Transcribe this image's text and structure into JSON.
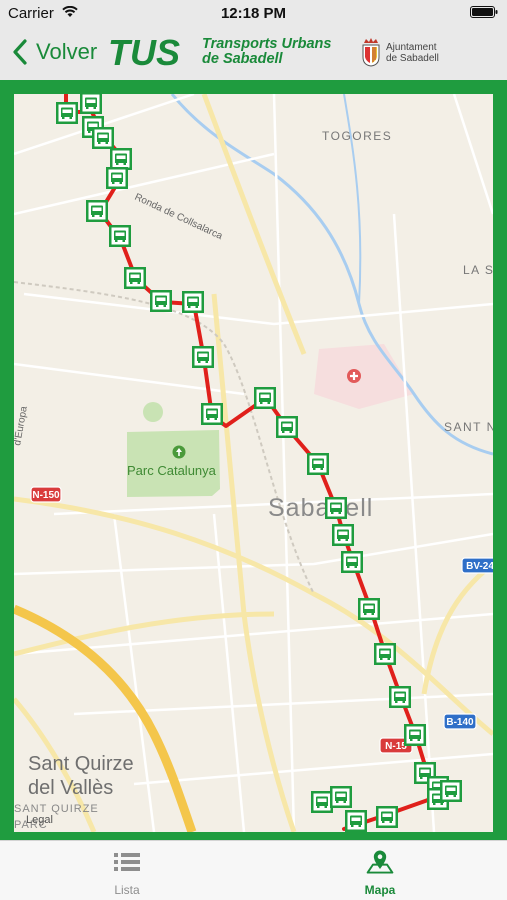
{
  "status": {
    "carrier": "Carrier",
    "time": "12:18 PM"
  },
  "nav": {
    "back_label": "Volver",
    "logo_text": "TUS",
    "line1": "Transports Urbans",
    "line2": "de Sabadell",
    "ajuntament_line1": "Ajuntament",
    "ajuntament_line2": "de Sabadell"
  },
  "map": {
    "labels": {
      "togores": "TOGORES",
      "la_s": "LA S",
      "sant_n": "SANT N",
      "ronda": "Ronda de Collsalarca",
      "europa": "d'Europa",
      "parc": "Parc Catalunya",
      "sabadell": "Sabadell",
      "sant_quirze_1": "Sant Quirze",
      "sant_quirze_2": "del Vallès",
      "sant_quirze_small": "SANT QUIRZE",
      "parc_small": "PARC",
      "legal": "Legal"
    },
    "road_badges": [
      "N-150",
      "BV-24",
      "B-140",
      "N-15"
    ],
    "route_color": "#e0201b",
    "stop_color": "#1f9c3f"
  },
  "tabs": [
    {
      "label": "Lista",
      "icon": "list-icon",
      "active": false
    },
    {
      "label": "Mapa",
      "icon": "map-pin-icon",
      "active": true
    }
  ],
  "colors": {
    "accent": "#1a8a3a",
    "frame": "#1f9c3f"
  }
}
